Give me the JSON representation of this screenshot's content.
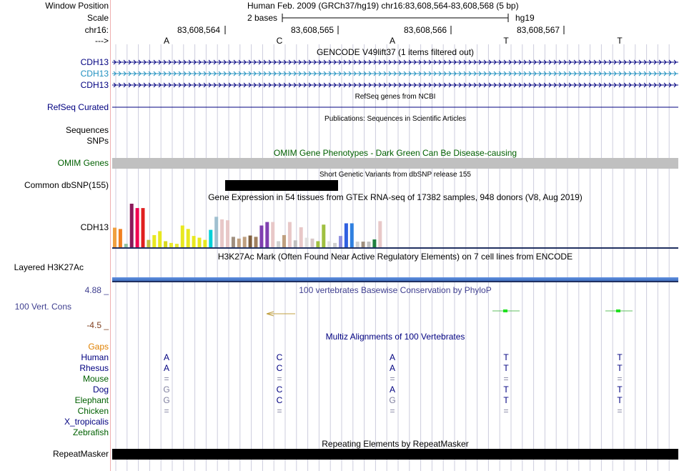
{
  "header": {
    "window_label": "Window Position",
    "window_value": "Human Feb. 2009 (GRCh37/hg19)   chr16:83,608,564-83,608,568 (5 bp)",
    "scale_label": "Scale",
    "scale_bases": "2 bases",
    "scale_assembly": "hg19",
    "chrom_label": "chr16:",
    "positions": [
      "83,608,564",
      "83,608,565",
      "83,608,566",
      "83,608,567"
    ],
    "strand_label": "--->",
    "bases": [
      "A",
      "C",
      "A",
      "T",
      "T"
    ]
  },
  "tracks": {
    "gencode_title": "GENCODE V49lift37 (1 items filtered out)",
    "gencode_items": [
      {
        "label": "CDH13",
        "color": "#000080"
      },
      {
        "label": "CDH13",
        "color": "#2090c0"
      },
      {
        "label": "CDH13",
        "color": "#000080"
      }
    ],
    "refseq_title": "RefSeq genes from NCBI",
    "refseq_label": "RefSeq Curated",
    "pubs_title": "Publications: Sequences in Scientific Articles",
    "pubs_labels": [
      "Sequences",
      "SNPs"
    ],
    "omim_title": "OMIM Gene Phenotypes - Dark Green Can Be Disease-causing",
    "omim_label": "OMIM Genes",
    "dbsnp_title": "Short Genetic Variants from dbSNP release 155",
    "dbsnp_label": "Common dbSNP(155)",
    "gtex_title": "Gene Expression in 54 tissues from GTEx RNA-seq of 17382 samples, 948 donors (V8, Aug 2019)",
    "gtex_label": "CDH13",
    "gtex_bars": [
      {
        "v": 0.45,
        "c": "#f0a040"
      },
      {
        "v": 0.42,
        "c": "#f08020"
      },
      {
        "v": 0.08,
        "c": "#90c0a0"
      },
      {
        "v": 1.0,
        "c": "#8b1a5a"
      },
      {
        "v": 0.9,
        "c": "#f00050"
      },
      {
        "v": 0.9,
        "c": "#e02020"
      },
      {
        "v": 0.17,
        "c": "#c0c040"
      },
      {
        "v": 0.28,
        "c": "#e8e820"
      },
      {
        "v": 0.37,
        "c": "#e8e820"
      },
      {
        "v": 0.14,
        "c": "#d8d820"
      },
      {
        "v": 0.1,
        "c": "#e8e830"
      },
      {
        "v": 0.08,
        "c": "#e8e830"
      },
      {
        "v": 0.5,
        "c": "#e8e820"
      },
      {
        "v": 0.42,
        "c": "#e8e820"
      },
      {
        "v": 0.26,
        "c": "#e8e820"
      },
      {
        "v": 0.22,
        "c": "#e8e820"
      },
      {
        "v": 0.17,
        "c": "#e8e820"
      },
      {
        "v": 0.4,
        "c": "#00d0d8"
      },
      {
        "v": 0.7,
        "c": "#a0c0d0"
      },
      {
        "v": 0.64,
        "c": "#e8c8c8"
      },
      {
        "v": 0.62,
        "c": "#e8c8c8"
      },
      {
        "v": 0.24,
        "c": "#a09080"
      },
      {
        "v": 0.2,
        "c": "#c0a080"
      },
      {
        "v": 0.24,
        "c": "#c0a080"
      },
      {
        "v": 0.27,
        "c": "#806040"
      },
      {
        "v": 0.24,
        "c": "#a08060"
      },
      {
        "v": 0.5,
        "c": "#8040b0"
      },
      {
        "v": 0.58,
        "c": "#8040b0"
      },
      {
        "v": 0.58,
        "c": "#e8c8c8"
      },
      {
        "v": 0.14,
        "c": "#d0d0d0"
      },
      {
        "v": 0.28,
        "c": "#c0a080"
      },
      {
        "v": 0.58,
        "c": "#e8c8c8"
      },
      {
        "v": 0.16,
        "c": "#c0c0c0"
      },
      {
        "v": 0.46,
        "c": "#e8c8c8"
      },
      {
        "v": 0.22,
        "c": "#e0e0e0"
      },
      {
        "v": 0.2,
        "c": "#d8c8c8"
      },
      {
        "v": 0.14,
        "c": "#a0c040"
      },
      {
        "v": 0.52,
        "c": "#a0c040"
      },
      {
        "v": 0.14,
        "c": "#e0e0e0"
      },
      {
        "v": 0.1,
        "c": "#d0d0d0"
      },
      {
        "v": 0.26,
        "c": "#9090e0"
      },
      {
        "v": 0.55,
        "c": "#3060e0"
      },
      {
        "v": 0.55,
        "c": "#3080e0"
      },
      {
        "v": 0.13,
        "c": "#d0d0d0"
      },
      {
        "v": 0.13,
        "c": "#a09080"
      },
      {
        "v": 0.13,
        "c": "#c0c0c0"
      },
      {
        "v": 0.18,
        "c": "#208040"
      },
      {
        "v": 0.6,
        "c": "#e8c8c8"
      }
    ],
    "h3k27ac_title": "H3K27Ac Mark (Often Found Near Active Regulatory Elements) on 7 cell lines from ENCODE",
    "h3k27ac_label": "Layered H3K27Ac",
    "phylop_title": "100 vertebrates Basewise Conservation by PhyloP",
    "phylop_label": "100 Vert. Cons",
    "phylop_max": "4.88 _",
    "phylop_min": "-4.5 _",
    "multiz_title": "Multiz Alignments of 100 Vertebrates",
    "multiz_species": [
      {
        "name": "Gaps",
        "color": "#e08000",
        "bases": [
          "",
          "",
          "",
          "",
          ""
        ],
        "bcolor": "#000080"
      },
      {
        "name": "Human",
        "color": "#000080",
        "bases": [
          "A",
          "C",
          "A",
          "T",
          "T"
        ],
        "bcolor": "#000080"
      },
      {
        "name": "Rhesus",
        "color": "#000080",
        "bases": [
          "A",
          "C",
          "A",
          "T",
          "T"
        ],
        "bcolor": "#000080"
      },
      {
        "name": "Mouse",
        "color": "#006000",
        "bases": [
          "=",
          "=",
          "=",
          "=",
          "="
        ],
        "bcolor": "#8080a0"
      },
      {
        "name": "Dog",
        "color": "#000080",
        "bases": [
          "G",
          "C",
          "A",
          "T",
          "T"
        ],
        "bcolor": "#000080"
      },
      {
        "name": "Elephant",
        "color": "#006000",
        "bases": [
          "G",
          "C",
          "G",
          "T",
          "T"
        ],
        "bcolor": "#000080"
      },
      {
        "name": "Chicken",
        "color": "#006000",
        "bases": [
          "=",
          "=",
          "=",
          "=",
          "="
        ],
        "bcolor": "#8080a0"
      },
      {
        "name": "X_tropicalis",
        "color": "#000080",
        "bases": [
          "",
          "",
          "",
          "",
          ""
        ],
        "bcolor": "#000080"
      },
      {
        "name": "Zebrafish",
        "color": "#006000",
        "bases": [
          "",
          "",
          "",
          "",
          ""
        ],
        "bcolor": "#000080"
      }
    ],
    "repeat_title": "Repeating Elements by RepeatMasker",
    "repeat_label": "RepeatMasker"
  },
  "colors": {
    "grid": "#ccccdd",
    "omim_bar": "#c0c0c0",
    "dark_navy": "#000080",
    "omim_green": "#006000",
    "phylop_blue": "#404090",
    "phylop_min_red": "#804020",
    "h3k27ac_bar": "#5080d0"
  }
}
